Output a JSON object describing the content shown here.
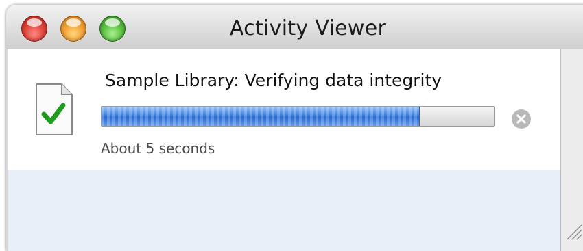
{
  "window": {
    "title": "Activity Viewer"
  },
  "titlebar": {
    "buttons": [
      "close-button",
      "minimize-button",
      "zoom-button"
    ]
  },
  "activity": {
    "title": "Sample Library: Verifying data integrity",
    "status": "About 5 seconds",
    "progress": 0.81,
    "icon": "document-checkmark-icon",
    "cancel_icon": "stop-circle-icon"
  },
  "colors": {
    "progress_fill": "#3a78dc",
    "list_background": "#e9eff9",
    "checkmark": "#1f9c1f"
  }
}
